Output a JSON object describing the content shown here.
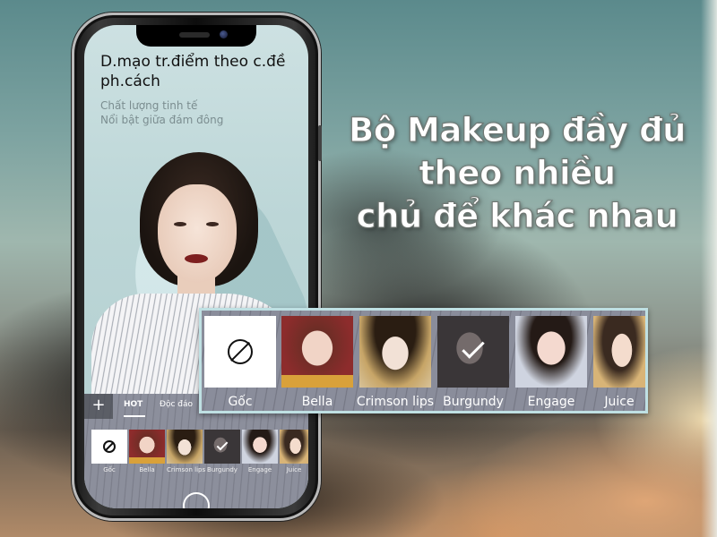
{
  "headline": {
    "lines": [
      "Bộ Makeup đầy đủ",
      "theo nhiều",
      "chủ để khác nhau"
    ]
  },
  "phone_screen": {
    "title_line1": "D.mạo tr.điểm theo c.đề",
    "title_line2": "ph.cách",
    "subtitle_line1": "Chất lượng tinh tế",
    "subtitle_line2": "Nổi bật giữa đám đông",
    "add_button": "+",
    "tabs": [
      {
        "label": "HOT",
        "active": true
      },
      {
        "label": "Độc đáo",
        "active": false
      }
    ],
    "presets": [
      {
        "label": "Gốc",
        "icon": "no-filter-icon",
        "selected": false
      },
      {
        "label": "Bella",
        "selected": false
      },
      {
        "label": "Crimson lips",
        "selected": false
      },
      {
        "label": "Burgundy",
        "selected": true
      },
      {
        "label": "Engage",
        "selected": false
      },
      {
        "label": "Juice",
        "selected": false
      }
    ]
  },
  "zoomed_presets": [
    {
      "label": "Gốc",
      "icon": "no-filter-icon",
      "selected": false
    },
    {
      "label": "Bella",
      "selected": false
    },
    {
      "label": "Crimson lips",
      "selected": false
    },
    {
      "label": "Burgundy",
      "selected": true
    },
    {
      "label": "Engage",
      "selected": false
    },
    {
      "label": "Juice",
      "selected": false
    }
  ],
  "colors": {
    "strip_border": "#bfe0e3",
    "panel_bg": "#8a8d9b",
    "screen_bg": "#cde1e2"
  }
}
